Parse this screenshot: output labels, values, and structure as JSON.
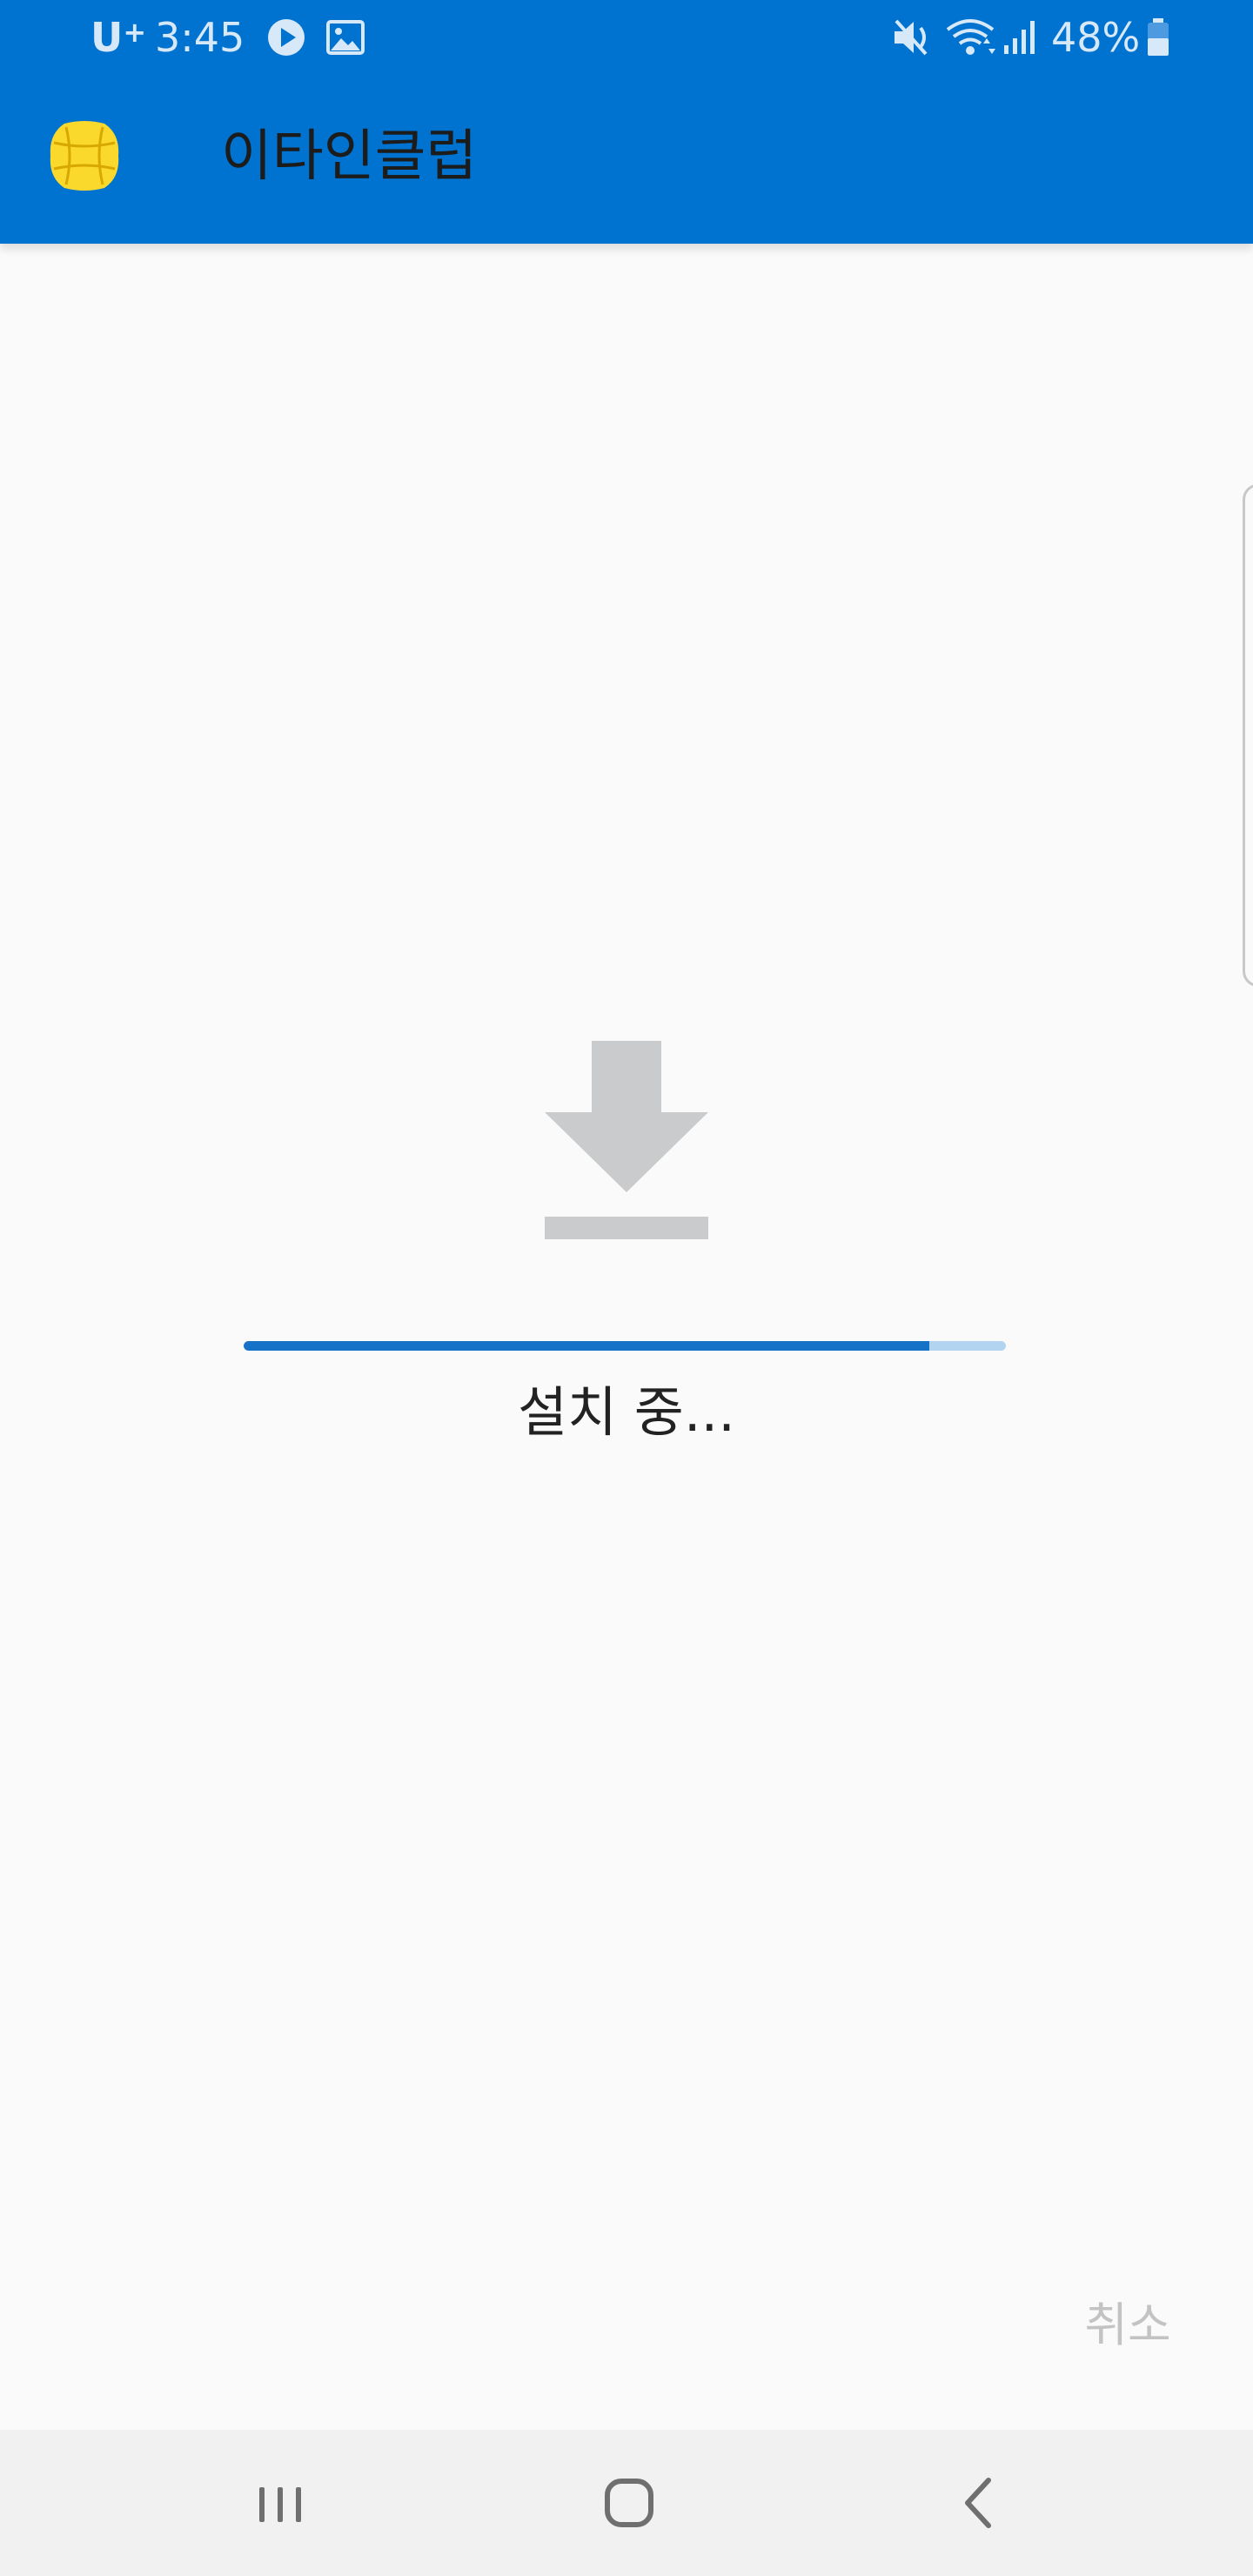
{
  "status_bar": {
    "carrier": "U",
    "carrier_sup": "+",
    "time": "3:45",
    "battery": "48%",
    "icons": [
      "play-icon",
      "image-icon",
      "mute-icon",
      "wifi-icon",
      "signal-icon",
      "battery-icon"
    ]
  },
  "app_bar": {
    "title": "이타인클럽",
    "logo": "app-logo-icon"
  },
  "install": {
    "icon": "download-icon",
    "progress": 0.9,
    "status": "설치 중..."
  },
  "actions": {
    "cancel_label": "취소"
  },
  "nav": {
    "items": [
      "recent-apps-icon",
      "home-icon",
      "back-icon"
    ]
  },
  "colors": {
    "primary": "#0073d1",
    "progress_fill": "#1672c7",
    "progress_track": "#b2d4f1",
    "icon_gray": "#c9cbcd"
  }
}
